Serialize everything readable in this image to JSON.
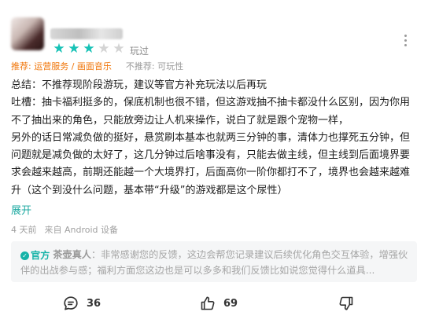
{
  "review": {
    "rating": 3,
    "max_rating": 5,
    "played_label": "玩过",
    "recommend_label": "推荐: 运营服务 / 画面音乐",
    "not_recommend_label": "不推荐: 可玩性",
    "paragraphs": [
      "总结：不推荐现阶段游玩，建议等官方补充玩法以后再玩",
      "吐槽：抽卡福利挺多的，保底机制也很不错，但这游戏抽不抽卡都没什么区别，因为你用不了抽出来的角色，只能放旁边让人机来操作，说白了就是跟个宠物一样，",
      "另外的话日常减负做的挺好，悬赏刷本基本也就两三分钟的事，清体力也撑死五分钟，但问题就是减负做的太好了，这几分钟过后啥事没有，只能去做主线，但主线到后面境界要求会越来越高，前期还能越一个大境界打，后面高你一阶你都打不了，境界也会越来越难升（这个到没什么问题，基本带“升级”的游戏都是这个尿性）"
    ],
    "expand_label": "展开",
    "time_ago": "4 天前",
    "device": "来自 Android 设备"
  },
  "official_reply": {
    "badge": "官方",
    "author": "茶壶真人",
    "text": "：非常感谢您的反馈，这边会帮您记录建议后续优化角色交互体验，增强伙伴的出战参与感；福利方面您这边也是可以多多和我们反馈比如说您觉得什么道具..."
  },
  "actions": {
    "comments": "36",
    "likes": "69"
  },
  "colors": {
    "accent": "#17c2b6",
    "recommend": "#f0760a"
  }
}
